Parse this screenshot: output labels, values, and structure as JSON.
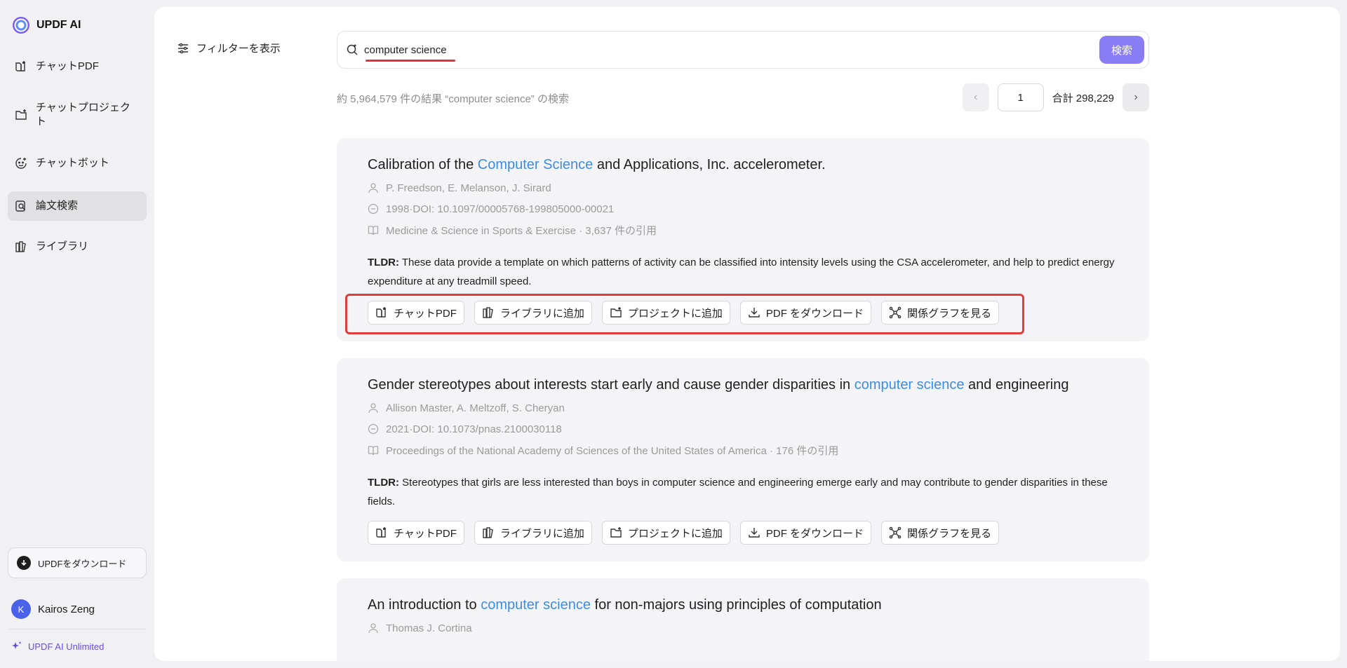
{
  "app": {
    "name": "UPDF AI"
  },
  "sidebar": {
    "items": [
      {
        "label": "チャットPDF"
      },
      {
        "label": "チャットプロジェクト"
      },
      {
        "label": "チャットボット"
      },
      {
        "label": "論文検索",
        "active": true
      },
      {
        "label": "ライブラリ"
      }
    ],
    "download_label": "UPDFをダウンロード",
    "user": {
      "initial": "K",
      "name": "Kairos Zeng"
    },
    "plan_label": "UPDF AI Unlimited"
  },
  "filter": {
    "label": "フィルターを表示"
  },
  "search": {
    "value": "computer science",
    "button_label": "検索"
  },
  "results": {
    "summary": "約 5,964,579 件の結果 “computer science” の検索",
    "page": "1",
    "total": "合計 298,229"
  },
  "actions_labels": {
    "chat": "チャットPDF",
    "library": "ライブラリに追加",
    "project": "プロジェクトに追加",
    "download": "PDF をダウンロード",
    "graph": "関係グラフを見る"
  },
  "papers": [
    {
      "title_pre": "Calibration of the ",
      "title_hl": "Computer Science",
      "title_post": " and Applications, Inc. accelerometer.",
      "authors": "P. Freedson,  E. Melanson,  J. Sirard",
      "doi": "1998·DOI: 10.1097/00005768-199805000-00021",
      "journal": "Medicine & Science in Sports & Exercise · 3,637 件の引用",
      "tldr_label": "TLDR:",
      "tldr": " These data provide a template on which patterns of activity can be classified into intensity levels using the CSA accelerometer, and help to predict energy expenditure at any treadmill speed."
    },
    {
      "title_pre": "Gender stereotypes about interests start early and cause gender disparities in ",
      "title_hl": "computer science",
      "title_post": " and engineering",
      "authors": "Allison Master,  A. Meltzoff,  S. Cheryan",
      "doi": "2021·DOI: 10.1073/pnas.2100030118",
      "journal": "Proceedings of the National Academy of Sciences of the United States of America · 176 件の引用",
      "tldr_label": "TLDR:",
      "tldr": " Stereotypes that girls are less interested than boys in computer science and engineering emerge early and may contribute to gender disparities in these fields."
    },
    {
      "title_pre": "An introduction to ",
      "title_hl": "computer science",
      "title_post": " for non-majors using principles of computation",
      "authors": "Thomas J. Cortina"
    }
  ],
  "colors": {
    "accent": "#8a7cf5",
    "highlight": "#3d8ce0",
    "annotation": "#e03c3c"
  },
  "icons": [
    "search-icon",
    "filter-icon",
    "person-icon",
    "doi-icon",
    "book-icon",
    "chat-pdf-icon",
    "library-icon",
    "folder-add-icon",
    "download-icon",
    "graph-icon",
    "sparkle-icon"
  ]
}
